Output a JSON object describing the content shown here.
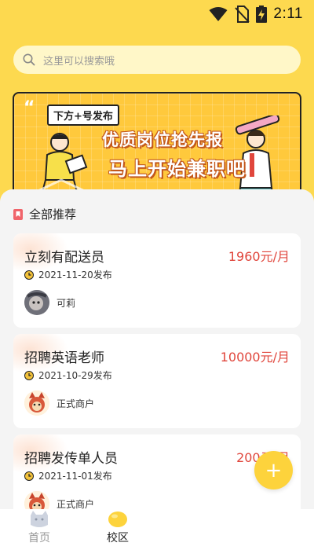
{
  "status_bar": {
    "time": "2:11",
    "icons": [
      "wifi-icon",
      "no-sim-icon",
      "battery-charging-icon"
    ]
  },
  "search": {
    "placeholder": "这里可以搜索哦",
    "icon": "search-icon"
  },
  "banner": {
    "tag": "下方+号发布",
    "line1": "优质岗位抢先报",
    "line2": "马上开始兼职吧"
  },
  "section": {
    "title": "全部推荐",
    "icon": "bookmark-icon"
  },
  "jobs": [
    {
      "title": "立刻有配送员",
      "salary": "1960元/月",
      "date": "2021-11-20发布",
      "poster": "可莉"
    },
    {
      "title": "招聘英语老师",
      "salary": "10000元/月",
      "date": "2021-10-29发布",
      "poster": "正式商户"
    },
    {
      "title": "招聘发传单人员",
      "salary": "200元/月",
      "date": "2021-11-01发布",
      "poster": "正式商户"
    }
  ],
  "fab": {
    "label": "+"
  },
  "nav": {
    "items": [
      {
        "label": "首页",
        "icon": "home-icon",
        "active": false
      },
      {
        "label": "校区",
        "icon": "campus-icon",
        "active": true
      }
    ]
  },
  "colors": {
    "background": "#fdd94f",
    "accent": "#fdd33c",
    "salary": "#e0463c",
    "banner": "#ffc93c"
  }
}
